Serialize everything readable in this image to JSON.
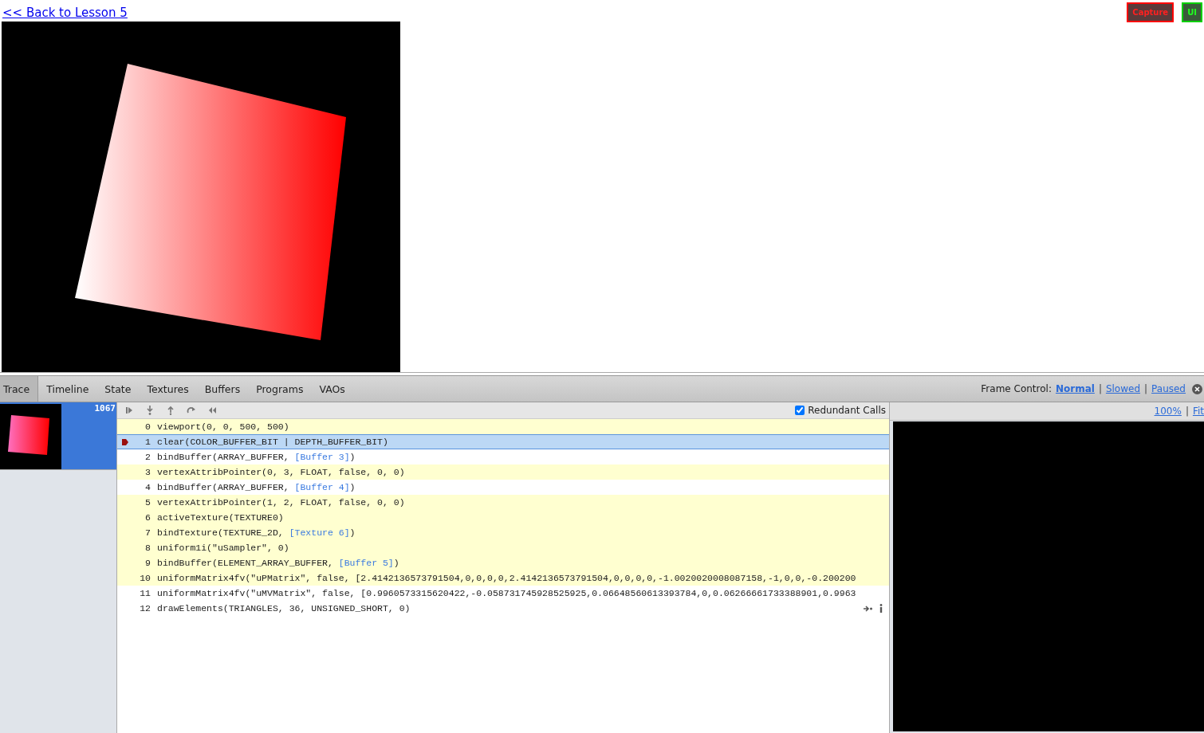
{
  "back_link": "<< Back to Lesson 5",
  "top_buttons": [
    {
      "label": "Capture",
      "kind": "capture"
    },
    {
      "label": "UI",
      "kind": "ui"
    }
  ],
  "tabs": [
    {
      "label": "Trace",
      "selected": true
    },
    {
      "label": "Timeline",
      "selected": false
    },
    {
      "label": "State",
      "selected": false
    },
    {
      "label": "Textures",
      "selected": false
    },
    {
      "label": "Buffers",
      "selected": false
    },
    {
      "label": "Programs",
      "selected": false
    },
    {
      "label": "VAOs",
      "selected": false
    }
  ],
  "frame_control": {
    "label": "Frame Control:",
    "separators": [
      "|",
      "|"
    ],
    "options": [
      {
        "label": "Normal",
        "selected": true
      },
      {
        "label": "Slowed",
        "selected": false
      },
      {
        "label": "Paused",
        "selected": false
      }
    ]
  },
  "frames": [
    {
      "number": "1067",
      "selected": true
    }
  ],
  "redundant_calls": {
    "label": "Redundant Calls",
    "checked": true
  },
  "calls": [
    {
      "index": "0",
      "redundant": true,
      "selected": false,
      "parts": [
        {
          "text": "viewport(0, 0, 500, 500)",
          "link": false
        }
      ]
    },
    {
      "index": "1",
      "selected": true,
      "parts": [
        {
          "text": "clear(COLOR_BUFFER_BIT | DEPTH_BUFFER_BIT)",
          "link": false
        }
      ]
    },
    {
      "index": "2",
      "redundant": false,
      "selected": false,
      "parts": [
        {
          "text": "bindBuffer(ARRAY_BUFFER, ",
          "link": false
        },
        {
          "text": "[Buffer 3]",
          "link": true
        },
        {
          "text": ")",
          "link": false
        }
      ]
    },
    {
      "index": "3",
      "redundant": true,
      "selected": false,
      "parts": [
        {
          "text": "vertexAttribPointer(0, 3, FLOAT, false, 0, 0)",
          "link": false
        }
      ]
    },
    {
      "index": "4",
      "redundant": false,
      "selected": false,
      "parts": [
        {
          "text": "bindBuffer(ARRAY_BUFFER, ",
          "link": false
        },
        {
          "text": "[Buffer 4]",
          "link": true
        },
        {
          "text": ")",
          "link": false
        }
      ]
    },
    {
      "index": "5",
      "redundant": true,
      "selected": false,
      "parts": [
        {
          "text": "vertexAttribPointer(1, 2, FLOAT, false, 0, 0)",
          "link": false
        }
      ]
    },
    {
      "index": "6",
      "redundant": true,
      "selected": false,
      "parts": [
        {
          "text": "activeTexture(TEXTURE0)",
          "link": false
        }
      ]
    },
    {
      "index": "7",
      "redundant": true,
      "selected": false,
      "parts": [
        {
          "text": "bindTexture(TEXTURE_2D, ",
          "link": false
        },
        {
          "text": "[Texture 6]",
          "link": true
        },
        {
          "text": ")",
          "link": false
        }
      ]
    },
    {
      "index": "8",
      "redundant": true,
      "selected": false,
      "parts": [
        {
          "text": "uniform1i(\"uSampler\", 0)",
          "link": false
        }
      ]
    },
    {
      "index": "9",
      "redundant": true,
      "selected": false,
      "parts": [
        {
          "text": "bindBuffer(ELEMENT_ARRAY_BUFFER, ",
          "link": false
        },
        {
          "text": "[Buffer 5]",
          "link": true
        },
        {
          "text": ")",
          "link": false
        }
      ]
    },
    {
      "index": "10",
      "redundant": true,
      "selected": false,
      "parts": [
        {
          "text": "uniformMatrix4fv(\"uPMatrix\", false, [2.4142136573791504,0,0,0,0,2.4142136573791504,0,0,0,0,-1.0020020008087158,-1,0,0,-0.200200",
          "link": false
        }
      ]
    },
    {
      "index": "11",
      "redundant": false,
      "selected": false,
      "parts": [
        {
          "text": "uniformMatrix4fv(\"uMVMatrix\", false, [0.9960573315620422,-0.058731745928525925,0.06648560613393784,0,0.06266661733388901,0.9963",
          "link": false
        }
      ]
    },
    {
      "index": "12",
      "redundant": false,
      "selected": false,
      "draw_call": true,
      "parts": [
        {
          "text": "drawElements(TRIANGLES, 36, UNSIGNED_SHORT, 0)",
          "link": false
        }
      ]
    }
  ],
  "zoom_links": [
    "100%",
    "Fit"
  ],
  "zoom_separators": [
    "|"
  ]
}
